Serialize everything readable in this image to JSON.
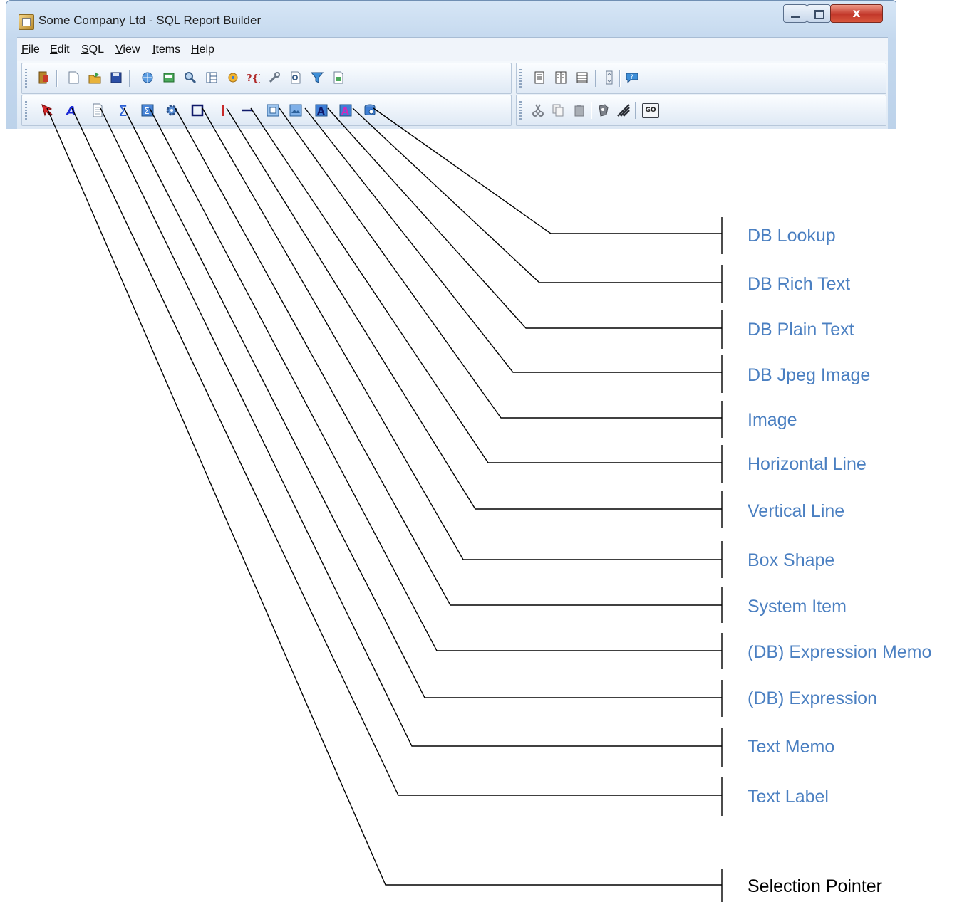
{
  "window": {
    "title": "Some Company Ltd - SQL Report Builder",
    "close_symbol": "x"
  },
  "menu": [
    {
      "accel": "F",
      "rest": "ile"
    },
    {
      "accel": "E",
      "rest": "dit"
    },
    {
      "accel": "S",
      "rest": "QL"
    },
    {
      "accel": "V",
      "rest": "iew"
    },
    {
      "accel": "I",
      "rest": "tems"
    },
    {
      "accel": "H",
      "rest": "elp"
    }
  ],
  "toolbar_icons_row1_left": [
    "exit-icon",
    "new-icon",
    "open-icon",
    "save-icon",
    "web-icon",
    "database-icon",
    "query-icon",
    "layout-icon",
    "gear-link-icon",
    "variables-icon",
    "wrench-icon",
    "preview-icon",
    "filter-icon",
    "report-icon"
  ],
  "toolbar_icons_row1_right": [
    "page-icon",
    "columns-icon",
    "rows-icon",
    "scroll-icon",
    "help-icon"
  ],
  "toolbar_icons_row2_right": [
    "cut-icon",
    "copy-icon",
    "paste-icon",
    "snap-icon",
    "hatch-icon"
  ],
  "toolbar_go_label": "GO",
  "callouts": [
    {
      "label": "DB Lookup",
      "icon": "db-lookup-icon"
    },
    {
      "label": "DB Rich Text",
      "icon": "db-rich-text-icon"
    },
    {
      "label": "DB Plain Text",
      "icon": "db-plain-text-icon"
    },
    {
      "label": "DB Jpeg Image",
      "icon": "db-jpeg-image-icon"
    },
    {
      "label": "Image",
      "icon": "image-icon"
    },
    {
      "label": "Horizontal Line",
      "icon": "horizontal-line-icon"
    },
    {
      "label": "Vertical Line",
      "icon": "vertical-line-icon"
    },
    {
      "label": "Box Shape",
      "icon": "box-shape-icon"
    },
    {
      "label": "System Item",
      "icon": "system-item-icon"
    },
    {
      "label": "(DB) Expression Memo",
      "icon": "expression-memo-icon"
    },
    {
      "label": "(DB) Expression",
      "icon": "expression-icon"
    },
    {
      "label": "Text Memo",
      "icon": "text-memo-icon"
    },
    {
      "label": "Text Label",
      "icon": "text-label-icon"
    },
    {
      "label": "Selection Pointer",
      "icon": "selection-pointer-icon"
    }
  ],
  "colors": {
    "callout_label": "#4a7fc1",
    "callout_label_pointer": "#000000",
    "text_label_icon": "#1d2bd6"
  }
}
